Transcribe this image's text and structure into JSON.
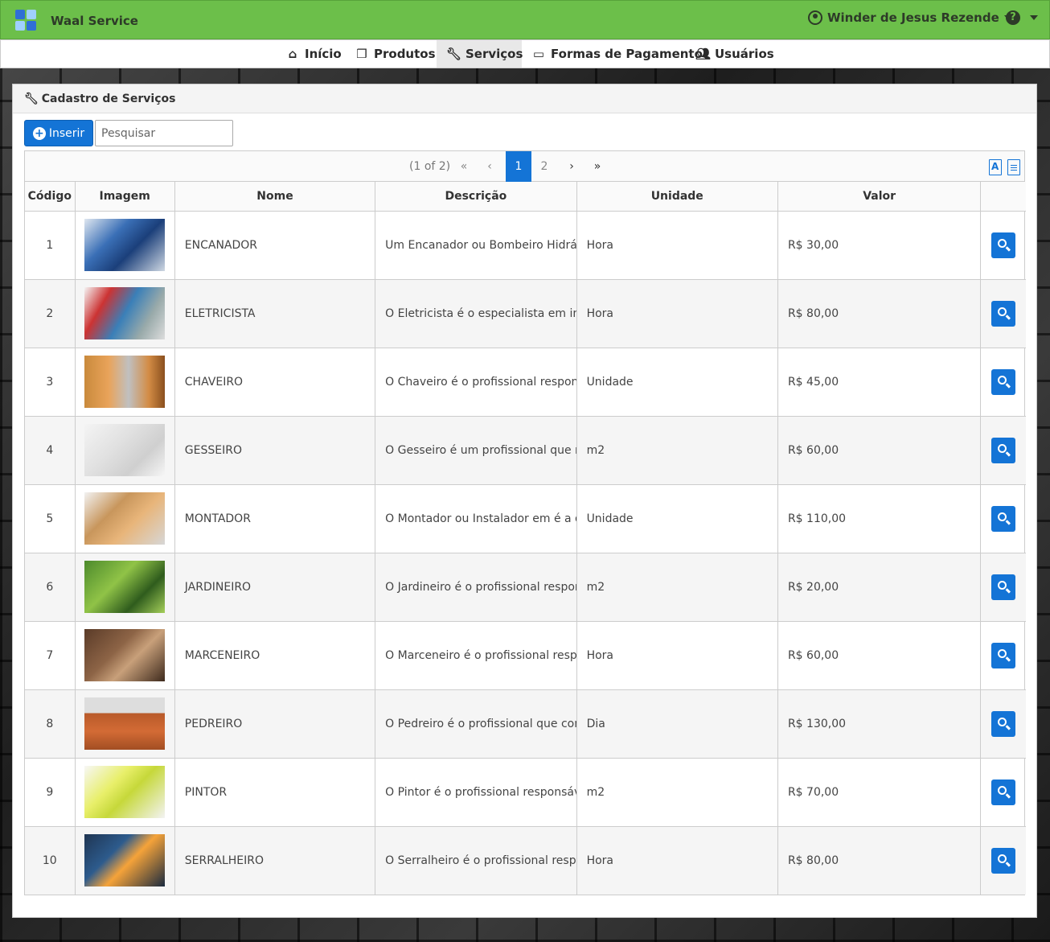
{
  "app": {
    "title": "Waal Service"
  },
  "user": {
    "name": "Winder de Jesus Rezende"
  },
  "help": {
    "icon": "question-circle-icon",
    "symbol": "?"
  },
  "nav": {
    "items": [
      {
        "label": "Início",
        "icon": "home-icon"
      },
      {
        "label": "Produtos",
        "icon": "cubes-icon"
      },
      {
        "label": "Serviços",
        "icon": "wrench-icon",
        "active": true
      },
      {
        "label": "Formas de Pagamento",
        "icon": "credit-card-icon"
      },
      {
        "label": "Usuários",
        "icon": "users-icon"
      }
    ]
  },
  "panel": {
    "title": "Cadastro de Serviços",
    "insert_label": "Inserir",
    "search_placeholder": "Pesquisar"
  },
  "paginator": {
    "info": "(1 of 2)",
    "pages": [
      "1",
      "2"
    ],
    "current_page": "1"
  },
  "table": {
    "columns": [
      "Código",
      "Imagem",
      "Nome",
      "Descrição",
      "Unidade",
      "Valor"
    ],
    "rows": [
      {
        "code": "1",
        "name": "ENCANADOR",
        "desc": "Um Encanador ou Bombeiro Hidráulico",
        "unit": "Hora",
        "value": "R$ 30,00"
      },
      {
        "code": "2",
        "name": "ELETRICISTA",
        "desc": "O Eletricista é o especialista em instalações",
        "unit": "Hora",
        "value": "R$ 80,00"
      },
      {
        "code": "3",
        "name": "CHAVEIRO",
        "desc": "O Chaveiro é o profissional responsável",
        "unit": "Unidade",
        "value": "R$ 45,00"
      },
      {
        "code": "4",
        "name": "GESSEIRO",
        "desc": "O Gesseiro é um profissional que realiza",
        "unit": "m2",
        "value": "R$ 60,00"
      },
      {
        "code": "5",
        "name": "MONTADOR",
        "desc": "O Montador ou Instalador em é a designação",
        "unit": "Unidade",
        "value": "R$ 110,00"
      },
      {
        "code": "6",
        "name": "JARDINEIRO",
        "desc": "O Jardineiro é o profissional responsável",
        "unit": "m2",
        "value": "R$ 20,00"
      },
      {
        "code": "7",
        "name": "MARCENEIRO",
        "desc": "O Marceneiro é o profissional responsável",
        "unit": "Hora",
        "value": "R$ 60,00"
      },
      {
        "code": "8",
        "name": "PEDREIRO",
        "desc": "O Pedreiro é o profissional que constrói",
        "unit": "Dia",
        "value": "R$ 130,00"
      },
      {
        "code": "9",
        "name": "PINTOR",
        "desc": "O Pintor é o profissional responsável",
        "unit": "m2",
        "value": "R$ 70,00"
      },
      {
        "code": "10",
        "name": "SERRALHEIRO",
        "desc": "O Serralheiro é o profissional responsável",
        "unit": "Hora",
        "value": "R$ 80,00"
      }
    ]
  }
}
